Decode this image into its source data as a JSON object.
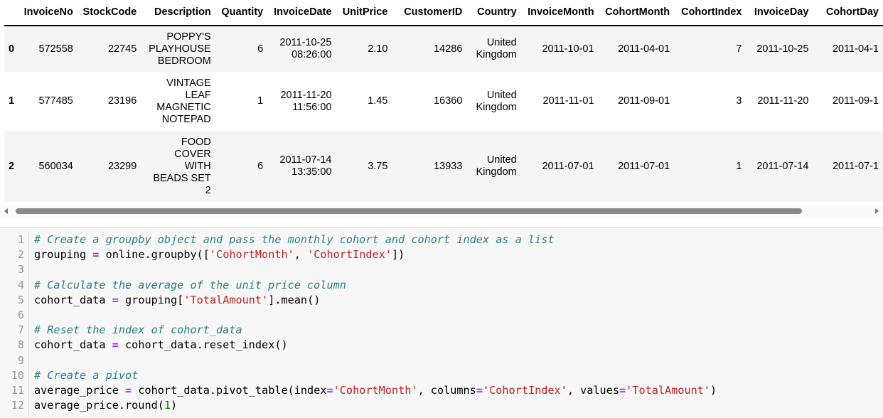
{
  "dataframe": {
    "columns": [
      "",
      "InvoiceNo",
      "StockCode",
      "Description",
      "Quantity",
      "InvoiceDate",
      "UnitPrice",
      "CustomerID",
      "Country",
      "InvoiceMonth",
      "CohortMonth",
      "CohortIndex",
      "InvoiceDay",
      "CohortDay"
    ],
    "rows": [
      {
        "index": "0",
        "InvoiceNo": "572558",
        "StockCode": "22745",
        "Description": [
          "POPPY'S",
          "PLAYHOUSE",
          "BEDROOM"
        ],
        "Quantity": "6",
        "InvoiceDate": [
          "2011-10-25",
          "08:26:00"
        ],
        "UnitPrice": "2.10",
        "CustomerID": "14286",
        "Country": [
          "United",
          "Kingdom"
        ],
        "InvoiceMonth": "2011-10-01",
        "CohortMonth": "2011-04-01",
        "CohortIndex": "7",
        "InvoiceDay": "2011-10-25",
        "CohortDay": "2011-04-1"
      },
      {
        "index": "1",
        "InvoiceNo": "577485",
        "StockCode": "23196",
        "Description": [
          "VINTAGE",
          "LEAF",
          "MAGNETIC",
          "NOTEPAD"
        ],
        "Quantity": "1",
        "InvoiceDate": [
          "2011-11-20",
          "11:56:00"
        ],
        "UnitPrice": "1.45",
        "CustomerID": "16360",
        "Country": [
          "United",
          "Kingdom"
        ],
        "InvoiceMonth": "2011-11-01",
        "CohortMonth": "2011-09-01",
        "CohortIndex": "3",
        "InvoiceDay": "2011-11-20",
        "CohortDay": "2011-09-1"
      },
      {
        "index": "2",
        "InvoiceNo": "560034",
        "StockCode": "23299",
        "Description": [
          "FOOD",
          "COVER",
          "WITH",
          "BEADS SET",
          "2"
        ],
        "Quantity": "6",
        "InvoiceDate": [
          "2011-07-14",
          "13:35:00"
        ],
        "UnitPrice": "3.75",
        "CustomerID": "13933",
        "Country": [
          "United",
          "Kingdom"
        ],
        "InvoiceMonth": "2011-07-01",
        "CohortMonth": "2011-07-01",
        "CohortIndex": "1",
        "InvoiceDay": "2011-07-14",
        "CohortDay": "2011-07-1"
      }
    ]
  },
  "scrollbar": {
    "horizontal_position_fraction": 0.0,
    "visible_fraction": 0.92
  },
  "code_cell": {
    "lines": [
      [
        {
          "t": "comment",
          "v": "# Create a groupby object and pass the monthly cohort and cohort index as a list"
        }
      ],
      [
        {
          "t": "plain",
          "v": "grouping "
        },
        {
          "t": "op",
          "v": "="
        },
        {
          "t": "plain",
          "v": " online.groupby(["
        },
        {
          "t": "string",
          "v": "'CohortMonth'"
        },
        {
          "t": "plain",
          "v": ", "
        },
        {
          "t": "string",
          "v": "'CohortIndex'"
        },
        {
          "t": "plain",
          "v": "])"
        }
      ],
      [],
      [
        {
          "t": "comment",
          "v": "# Calculate the average of the unit price column"
        }
      ],
      [
        {
          "t": "plain",
          "v": "cohort_data "
        },
        {
          "t": "op",
          "v": "="
        },
        {
          "t": "plain",
          "v": " grouping["
        },
        {
          "t": "string",
          "v": "'TotalAmount'"
        },
        {
          "t": "plain",
          "v": "].mean()"
        }
      ],
      [],
      [
        {
          "t": "comment",
          "v": "# Reset the index of cohort_data"
        }
      ],
      [
        {
          "t": "plain",
          "v": "cohort_data "
        },
        {
          "t": "op",
          "v": "="
        },
        {
          "t": "plain",
          "v": " cohort_data.reset_index()"
        }
      ],
      [],
      [
        {
          "t": "comment",
          "v": "# Create a pivot"
        }
      ],
      [
        {
          "t": "plain",
          "v": "average_price "
        },
        {
          "t": "op",
          "v": "="
        },
        {
          "t": "plain",
          "v": " cohort_data.pivot_table(index"
        },
        {
          "t": "op",
          "v": "="
        },
        {
          "t": "string",
          "v": "'CohortMonth'"
        },
        {
          "t": "plain",
          "v": ", columns"
        },
        {
          "t": "op",
          "v": "="
        },
        {
          "t": "string",
          "v": "'CohortIndex'"
        },
        {
          "t": "plain",
          "v": ", values"
        },
        {
          "t": "op",
          "v": "="
        },
        {
          "t": "string",
          "v": "'TotalAmount'"
        },
        {
          "t": "plain",
          "v": ")"
        }
      ],
      [
        {
          "t": "plain",
          "v": "average_price.round("
        },
        {
          "t": "num",
          "v": "1"
        },
        {
          "t": "plain",
          "v": ")"
        }
      ]
    ]
  }
}
